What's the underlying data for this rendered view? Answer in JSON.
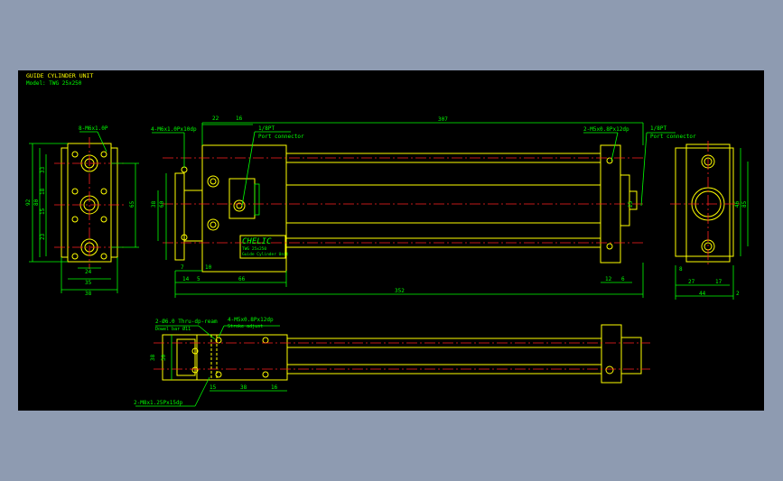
{
  "drawing": {
    "title": "GUIDE CYLINDER UNIT",
    "model": "Model: TWG 25x250"
  },
  "callouts": {
    "left_top_holes": "8-M6x1.0P",
    "top_left_holes": "4-M6x1.0Px10dp",
    "port_a": "1/8PT",
    "port_a_sub": "Port connector",
    "top_right_holes": "2-M5x0.8Px12dp",
    "port_b": "1/8PT",
    "port_b_sub": "Port connector",
    "bottom_pin": "2-Ø6.0 Thru-dp-ream",
    "bottom_pin_sub": "Dowel bar Ø11",
    "bottom_holes": "4-M5x0.8Px12dp",
    "bottom_holes_sub": "Stroke adjust",
    "bottom_lower_holes": "2-M8x1.25Px15dp",
    "nameplate": "CHELIC",
    "nameplate_sub1": "TWG 25x250",
    "nameplate_sub2": "Guide Cylinder Unit"
  },
  "dimensions": {
    "left_view": {
      "w38": "38",
      "w35": "35",
      "w24": "24",
      "h92": "92",
      "h80": "80",
      "h65": "65",
      "h33": "33",
      "h18": "18",
      "h15": "15",
      "h23": "23",
      "h13": "13"
    },
    "front_view": {
      "d22": "22",
      "d16": "16",
      "d307": "307",
      "d352": "352",
      "d66": "66",
      "d14": "14",
      "d5": "5",
      "d7": "7",
      "d10": "10",
      "d12": "12",
      "d6": "6",
      "d25": "25",
      "d60": "60",
      "d38": "38"
    },
    "right_view": {
      "d27": "27",
      "d17": "17",
      "d44": "44",
      "d2": "2",
      "d85": "85",
      "d46": "46",
      "d8": "8"
    },
    "bottom_view": {
      "d38": "38",
      "d30": "30",
      "d15": "15",
      "d38b": "38",
      "d16": "16"
    }
  },
  "colors": {
    "background": "#000000",
    "frame": "#8e9bb1",
    "outline": "#ffff00",
    "dimension": "#00ff00",
    "centerline": "#ff2020"
  }
}
